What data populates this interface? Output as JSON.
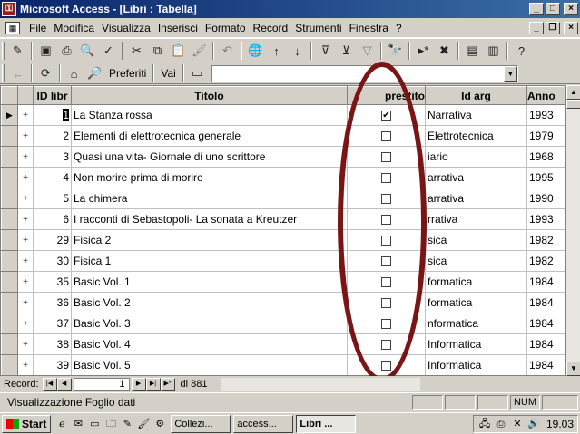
{
  "window": {
    "title": "Microsoft Access - [Libri : Tabella]"
  },
  "menu": [
    "File",
    "Modifica",
    "Visualizza",
    "Inserisci",
    "Formato",
    "Record",
    "Strumenti",
    "Finestra",
    "?"
  ],
  "web_toolbar": {
    "favorites": "Preferiti",
    "go": "Vai"
  },
  "table": {
    "columns": [
      "ID libr",
      "Titolo",
      "prestito",
      "Id arg",
      "Anno"
    ],
    "rows": [
      {
        "id": "1",
        "titolo": "La Stanza rossa",
        "prestito": "✔",
        "arg": "Narrativa",
        "anno": "1993"
      },
      {
        "id": "2",
        "titolo": "Elementi di elettrotecnica generale",
        "prestito": "",
        "arg": "Elettrotecnica",
        "anno": "1979"
      },
      {
        "id": "3",
        "titolo": "Quasi una vita- Giornale di uno scrittore",
        "prestito": "",
        "arg": "iario",
        "anno": "1968"
      },
      {
        "id": "4",
        "titolo": "Non morire prima di morire",
        "prestito": "",
        "arg": "arrativa",
        "anno": "1995"
      },
      {
        "id": "5",
        "titolo": "La chimera",
        "prestito": "",
        "arg": "arrativa",
        "anno": "1990"
      },
      {
        "id": "6",
        "titolo": "I racconti di Sebastopoli- La sonata a Kreutzer",
        "prestito": "",
        "arg": "rrativa",
        "anno": "1993"
      },
      {
        "id": "29",
        "titolo": "Fisica 2",
        "prestito": "",
        "arg": "sica",
        "anno": "1982"
      },
      {
        "id": "30",
        "titolo": "Fisica 1",
        "prestito": "",
        "arg": "sica",
        "anno": "1982"
      },
      {
        "id": "35",
        "titolo": "Basic Vol. 1",
        "prestito": "",
        "arg": "formatica",
        "anno": "1984"
      },
      {
        "id": "36",
        "titolo": "Basic Vol. 2",
        "prestito": "",
        "arg": "formatica",
        "anno": "1984"
      },
      {
        "id": "37",
        "titolo": "Basic Vol. 3",
        "prestito": "",
        "arg": "nformatica",
        "anno": "1984"
      },
      {
        "id": "38",
        "titolo": "Basic Vol. 4",
        "prestito": "",
        "arg": "Informatica",
        "anno": "1984"
      },
      {
        "id": "39",
        "titolo": "Basic Vol. 5",
        "prestito": "",
        "arg": "Informatica",
        "anno": "1984"
      }
    ]
  },
  "navigation": {
    "label": "Record:",
    "current": "1",
    "total": "di 881"
  },
  "status": {
    "text": "Visualizzazione Foglio dati",
    "num": "NUM"
  },
  "taskbar": {
    "start": "Start",
    "tasks": [
      "Collezi...",
      "access...",
      "Libri ..."
    ],
    "clock": "19.03"
  },
  "colors": {
    "title_start": "#0a246a",
    "title_end": "#3a6ea5",
    "annotation_oval": "#7a1515"
  }
}
